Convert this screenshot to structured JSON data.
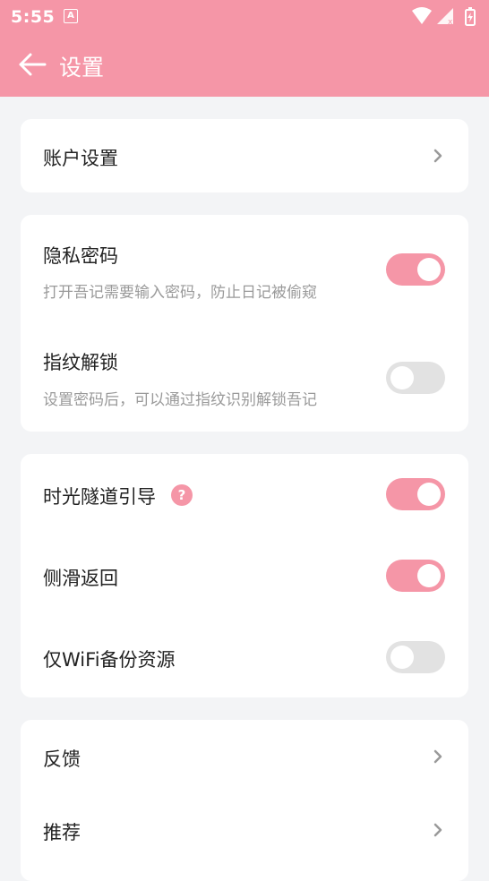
{
  "status_bar": {
    "time": "5:55",
    "notification_icon": "A"
  },
  "app_bar": {
    "title": "设置"
  },
  "account": {
    "label": "账户设置"
  },
  "privacy": {
    "password": {
      "label": "隐私密码",
      "desc": "打开吾记需要输入密码，防止日记被偷窥",
      "enabled": true
    },
    "fingerprint": {
      "label": "指纹解锁",
      "desc": "设置密码后，可以通过指纹识别解锁吾记",
      "enabled": false
    }
  },
  "general": {
    "tunnel_guide": {
      "label": "时光隧道引导",
      "help": "?",
      "enabled": true
    },
    "swipe_back": {
      "label": "侧滑返回",
      "enabled": true
    },
    "wifi_backup": {
      "label": "仅WiFi备份资源",
      "enabled": false
    }
  },
  "misc": {
    "feedback": {
      "label": "反馈"
    },
    "recommend": {
      "label": "推荐"
    }
  },
  "colors": {
    "accent": "#f596a7",
    "background": "#f3f4f6",
    "toggle_off": "#e2e2e2"
  }
}
